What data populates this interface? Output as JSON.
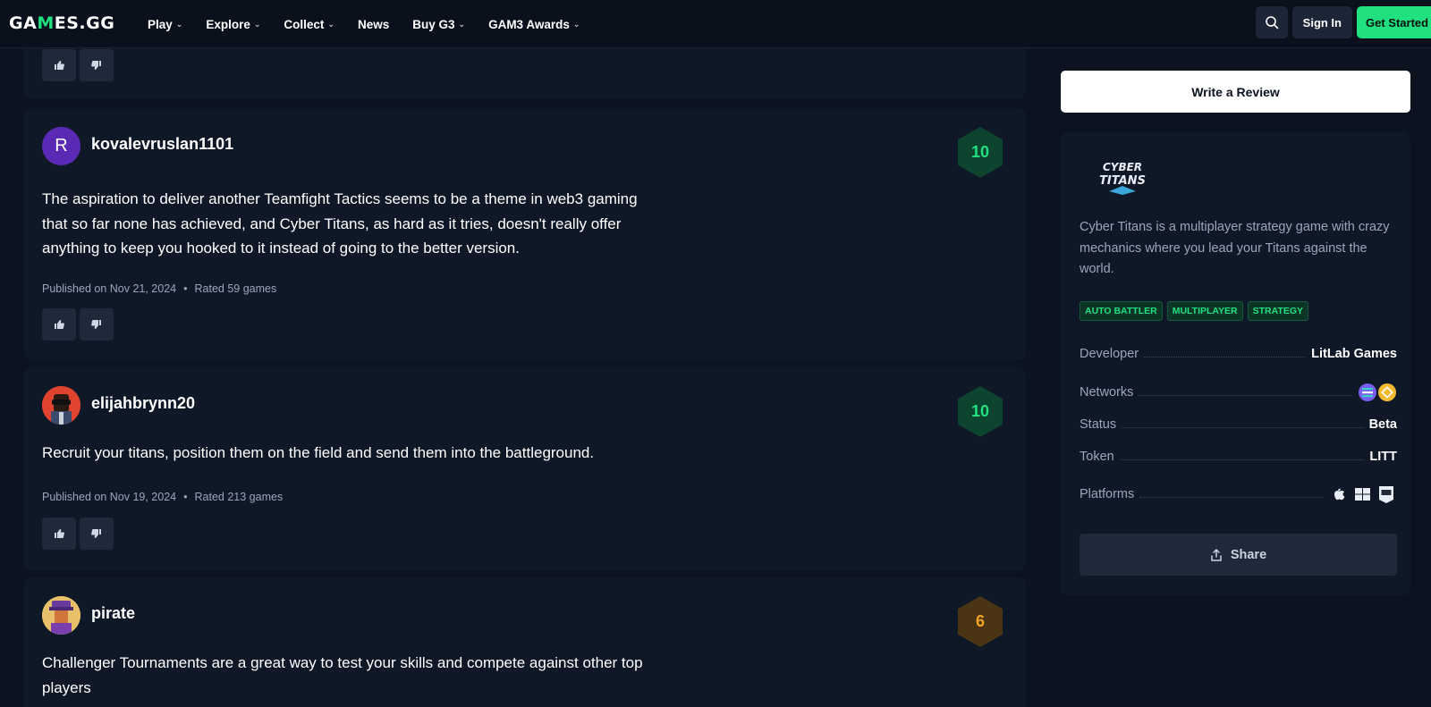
{
  "nav": {
    "logo": "GAMES.GG",
    "items": [
      {
        "label": "Play",
        "dropdown": true
      },
      {
        "label": "Explore",
        "dropdown": true
      },
      {
        "label": "Collect",
        "dropdown": true
      },
      {
        "label": "News",
        "dropdown": false
      },
      {
        "label": "Buy G3",
        "dropdown": true
      },
      {
        "label": "GAM3 Awards",
        "dropdown": true
      }
    ],
    "search_icon": "search-icon",
    "signin": "Sign In",
    "get_started": "Get Started"
  },
  "reviews": [
    {
      "username": "kovalevruslan1101",
      "avatar_letter": "R",
      "score": "10",
      "text": "The aspiration to deliver another Teamfight Tactics seems to be a theme in web3 gaming that so far none has achieved, and Cyber Titans, as hard as it tries, doesn't really offer anything to keep you hooked to it instead of going to the better version.",
      "published": "Published on Nov 21, 2024",
      "rated": "Rated 59 games"
    },
    {
      "username": "elijahbrynn20",
      "score": "10",
      "text": "Recruit your titans, position them on the field and send them into the battleground.",
      "published": "Published on Nov 19, 2024",
      "rated": "Rated 213 games"
    },
    {
      "username": "pirate",
      "score": "6",
      "text": "Challenger Tournaments are a great way to test your skills and compete against other top players"
    }
  ],
  "sidebar": {
    "write_review": "Write a Review",
    "logo_text_1": "CYBER",
    "logo_text_2": "TITANS",
    "description": "Cyber Titans is a multiplayer strategy game with crazy mechanics where you lead your Titans against the world.",
    "tags": [
      "AUTO BATTLER",
      "MULTIPLAYER",
      "STRATEGY"
    ],
    "developer_label": "Developer",
    "developer": "LitLab Games",
    "networks_label": "Networks",
    "status_label": "Status",
    "status": "Beta",
    "token_label": "Token",
    "token": "LITT",
    "platforms_label": "Platforms",
    "share": "Share"
  },
  "colors": {
    "accent": "#21e07f",
    "background": "#0b1220",
    "card": "#0f1827",
    "score_orange": "#f5a524"
  }
}
